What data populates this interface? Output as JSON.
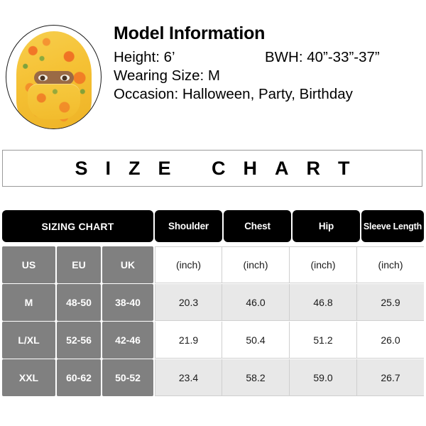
{
  "model_info": {
    "title": "Model Information",
    "height_label": "Height: 6’",
    "bwh_label": "BWH: 40”-33”-37”",
    "wearing_size": "Wearing Size: M",
    "occasion": "Occasion: Halloween, Party, Birthday",
    "photo_alt": "model-wearing-yellow-floral-veil"
  },
  "banner": {
    "text": "SIZE CHART"
  },
  "table": {
    "header": {
      "sizing_chart": "SIZING CHART",
      "columns": [
        "Shoulder",
        "Chest",
        "Hip",
        "Sleeve Length"
      ]
    },
    "region_headers": [
      "US",
      "EU",
      "UK"
    ],
    "unit_row": [
      "(inch)",
      "(inch)",
      "(inch)",
      "(inch)"
    ],
    "rows": [
      {
        "us": "M",
        "eu": "48-50",
        "uk": "38-40",
        "shoulder": "20.3",
        "chest": "46.0",
        "hip": "46.8",
        "sleeve_length": "25.9"
      },
      {
        "us": "L/XL",
        "eu": "52-56",
        "uk": "42-46",
        "shoulder": "21.9",
        "chest": "50.4",
        "hip": "51.2",
        "sleeve_length": "26.0"
      },
      {
        "us": "XXL",
        "eu": "60-62",
        "uk": "50-52",
        "shoulder": "23.4",
        "chest": "58.2",
        "hip": "59.0",
        "sleeve_length": "26.7"
      }
    ]
  },
  "colors": {
    "header_bar": "#000000",
    "region_cell": "#808080",
    "shaded_row": "#e8e8e8",
    "grid_line": "#cfcfcf",
    "banner_border": "#9a9a9a"
  }
}
